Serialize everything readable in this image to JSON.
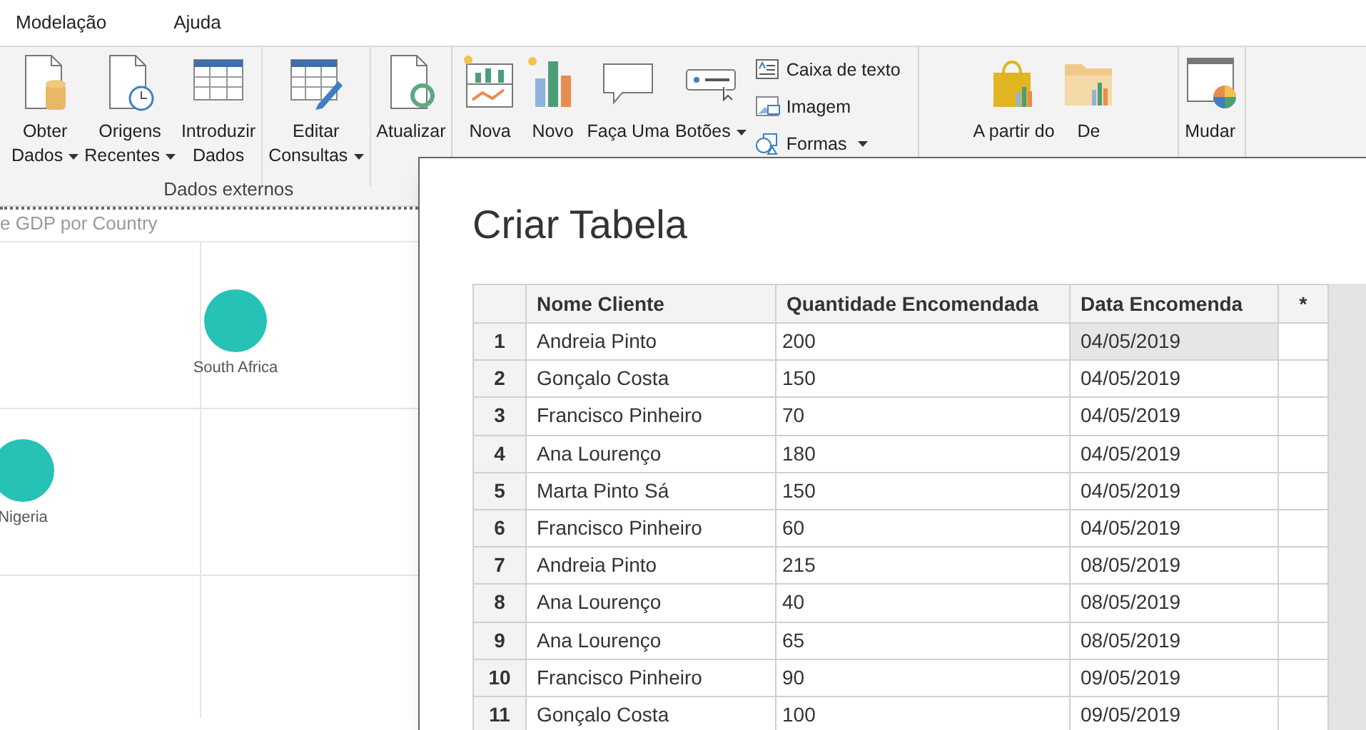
{
  "menu": [
    {
      "label": "Modelação"
    },
    {
      "label": "Ajuda"
    }
  ],
  "ribbon": {
    "groups": [
      {
        "label": "Dados externos",
        "sections": [
          [
            {
              "kind": "large",
              "lines": [
                "Obter",
                "Dados"
              ],
              "dropdown": true
            },
            {
              "kind": "large",
              "lines": [
                "Origens",
                "Recentes"
              ],
              "dropdown": true
            },
            {
              "kind": "large",
              "lines": [
                "Introduzir",
                "Dados"
              ],
              "dropdown": false
            }
          ],
          [
            {
              "kind": "large",
              "lines": [
                "Editar",
                "Consultas"
              ],
              "dropdown": true
            }
          ],
          [
            {
              "kind": "large",
              "lines": [
                "Atualizar"
              ],
              "dropdown": false
            }
          ]
        ]
      },
      {
        "sections": [
          [
            {
              "kind": "large",
              "lines": [
                "Nova"
              ],
              "dropdown": false
            },
            {
              "kind": "large",
              "lines": [
                "Novo"
              ],
              "dropdown": false
            },
            {
              "kind": "large",
              "lines": [
                "Faça Uma"
              ],
              "dropdown": false
            },
            {
              "kind": "large",
              "lines": [
                "Botões"
              ],
              "dropdown": true
            },
            {
              "kind": "small",
              "items": [
                {
                  "label": "Caixa de texto",
                  "dropdown": false
                },
                {
                  "label": "Imagem",
                  "dropdown": false
                },
                {
                  "label": "Formas",
                  "dropdown": true
                }
              ]
            }
          ]
        ]
      },
      {
        "sections": [
          [
            {
              "kind": "large",
              "lines": [
                "A partir do"
              ],
              "dropdown": false
            },
            {
              "kind": "large",
              "lines": [
                "De"
              ],
              "dropdown": false
            }
          ]
        ]
      },
      {
        "sections": [
          [
            {
              "kind": "large",
              "lines": [
                "Mudar"
              ],
              "dropdown": false
            }
          ]
        ]
      }
    ]
  },
  "visual": {
    "title": "e GDP por Country",
    "points": [
      {
        "label": "South Africa"
      },
      {
        "label": "Nigeria"
      }
    ]
  },
  "dialog": {
    "title": "Criar Tabela",
    "columns": [
      "Nome Cliente",
      "Quantidade Encomendada",
      "Data Encomenda",
      "*"
    ],
    "rows": [
      {
        "n": "1",
        "name": "Andreia Pinto",
        "qty": "200",
        "date": "04/05/2019",
        "selected": true
      },
      {
        "n": "2",
        "name": "Gonçalo Costa",
        "qty": "150",
        "date": "04/05/2019",
        "selected": false
      },
      {
        "n": "3",
        "name": "Francisco Pinheiro",
        "qty": "70",
        "date": "04/05/2019",
        "selected": false
      },
      {
        "n": "4",
        "name": "Ana Lourenço",
        "qty": "180",
        "date": "04/05/2019",
        "selected": false
      },
      {
        "n": "5",
        "name": "Marta Pinto Sá",
        "qty": "150",
        "date": "04/05/2019",
        "selected": false
      },
      {
        "n": "6",
        "name": "Francisco Pinheiro",
        "qty": "60",
        "date": "04/05/2019",
        "selected": false
      },
      {
        "n": "7",
        "name": "Andreia Pinto",
        "qty": "215",
        "date": "08/05/2019",
        "selected": false
      },
      {
        "n": "8",
        "name": "Ana Lourenço",
        "qty": "40",
        "date": "08/05/2019",
        "selected": false
      },
      {
        "n": "9",
        "name": "Ana Lourenço",
        "qty": "65",
        "date": "08/05/2019",
        "selected": false
      },
      {
        "n": "10",
        "name": "Francisco Pinheiro",
        "qty": "90",
        "date": "09/05/2019",
        "selected": false
      },
      {
        "n": "11",
        "name": "Gonçalo Costa",
        "qty": "100",
        "date": "09/05/2019",
        "selected": false
      }
    ]
  }
}
